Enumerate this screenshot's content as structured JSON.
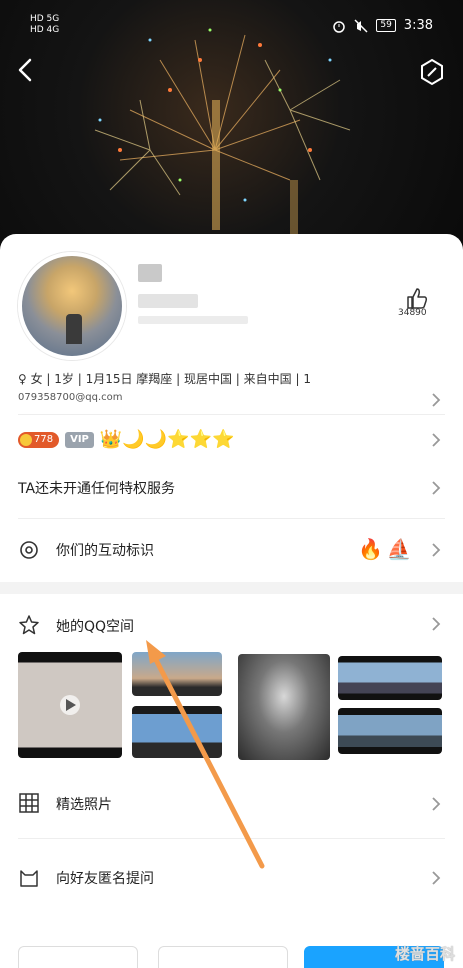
{
  "status_bar": {
    "network_top": "HD 5G",
    "network_bottom": "HD 4G",
    "battery": "59",
    "time": "3:38"
  },
  "header": {
    "back_icon": "back-chevron-icon",
    "edit_icon": "edit-hexagon-icon"
  },
  "profile": {
    "likes": "34890",
    "info_line": "♀ 女 | 1岁 | 1月15日 摩羯座 | 现居中国 | 来自中国 | 1",
    "email": "079358700@qq.com"
  },
  "level": {
    "badge": "778",
    "vip": "VIP",
    "icons": "👑🌙🌙⭐⭐⭐"
  },
  "rows": {
    "privilege": "TA还未开通任何特权服务",
    "interaction": "你们的互动标识",
    "interaction_icons": "🔥⛵",
    "qzone": "她的QQ空间",
    "photos": "精选照片",
    "anon_question": "向好友匿名提问"
  },
  "footer": {
    "watermark": "楼啬百科"
  },
  "colors": {
    "accent": "#1aa3ff",
    "arrow": "#f39a4a",
    "level_badge": "#e25a2a"
  }
}
